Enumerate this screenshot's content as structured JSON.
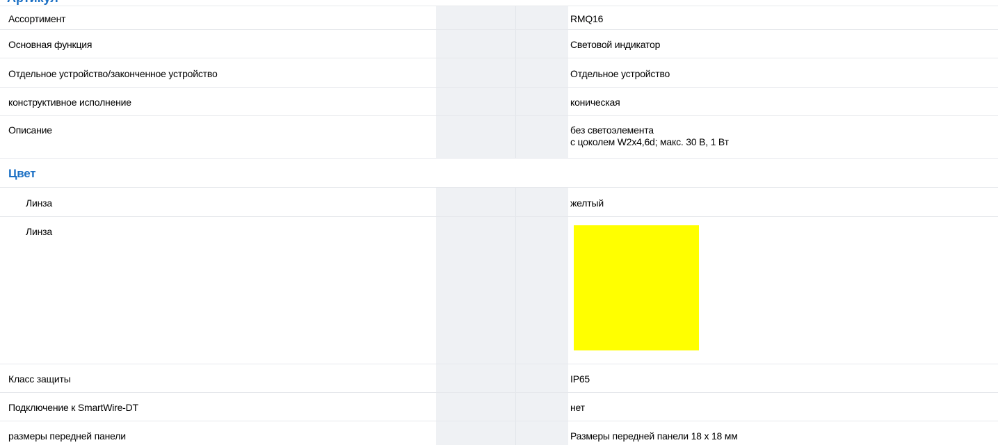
{
  "top_fragment": "Артикул",
  "rows": [
    {
      "label": "Ассортимент",
      "value": "RMQ16"
    },
    {
      "label": "Основная функция",
      "value": "Световой индикатор"
    },
    {
      "label": "Отдельное устройство/законченное устройство",
      "value": "Отдельное устройство"
    },
    {
      "label": "конструктивное исполнение",
      "value": "коническая"
    },
    {
      "label": "Описание",
      "value_lines": [
        "без светоэлемента",
        "с цоколем W2x4,6d; макс. 30 В, 1 Вт"
      ]
    }
  ],
  "section": {
    "heading": "Цвет",
    "rows": [
      {
        "label": "Линза",
        "value": "желтый"
      },
      {
        "label": "Линза",
        "swatch_color": "#ffff00"
      }
    ]
  },
  "rows_after": [
    {
      "label": "Класс защиты",
      "value": "IP65"
    },
    {
      "label": "Подключение к SmartWire-DT",
      "value": "нет"
    },
    {
      "label": "размеры передней панели",
      "value": "Размеры передней панели 18 x 18 мм"
    }
  ]
}
